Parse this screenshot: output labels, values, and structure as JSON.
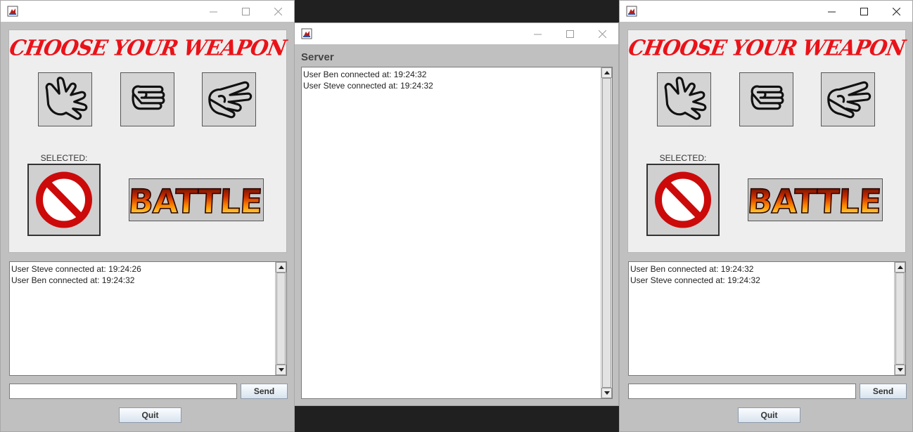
{
  "client_left": {
    "title": "CHOOSE YOUR WEAPON",
    "selected_label": "SELECTED:",
    "messages": [
      "User Steve connected at: 19:24:26",
      "User Ben connected at: 19:24:32"
    ],
    "message_input": "",
    "send_label": "Send",
    "quit_label": "Quit",
    "battle_text": "BATTLE"
  },
  "server": {
    "title": "Server",
    "messages": [
      "User Ben connected at: 19:24:32",
      "User Steve connected at: 19:24:32"
    ]
  },
  "client_right": {
    "title": "CHOOSE YOUR WEAPON",
    "selected_label": "SELECTED:",
    "messages": [
      "User Ben connected at: 19:24:32",
      "User Steve connected at: 19:24:32"
    ],
    "message_input": "",
    "send_label": "Send",
    "quit_label": "Quit",
    "battle_text": "BATTLE"
  },
  "weapons": [
    "paper",
    "rock",
    "scissors"
  ],
  "icons": {
    "app": "java-app-icon",
    "minimize": "minimize-icon",
    "maximize": "maximize-icon",
    "close": "close-icon",
    "selected_none": "prohibited-icon"
  },
  "colors": {
    "title_red": "#ea1218",
    "prohibit_red": "#cc0a0a",
    "window_bg": "#c0c0c0",
    "panel_bg": "#eeeeee"
  }
}
